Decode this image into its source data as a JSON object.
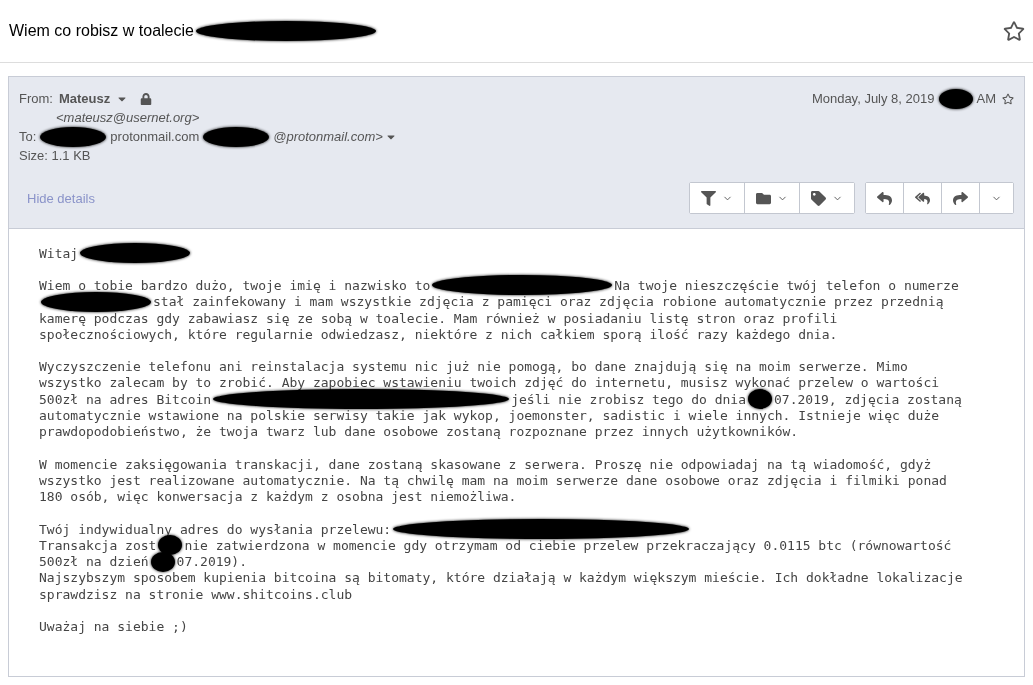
{
  "subject": {
    "segments": [
      {
        "kind": "text",
        "text": "Wiem co robisz w toalecie"
      },
      {
        "kind": "redaction_xl"
      }
    ],
    "starred": false
  },
  "header": {
    "from_label": "From:",
    "sender_name": "Mateusz",
    "sender_email": "<mateusz@usernet.org>",
    "to_label": "To:",
    "to_segments": [
      {
        "kind": "redaction_m"
      },
      {
        "kind": "text",
        "text": "protonmail.com"
      },
      {
        "kind": "redaction_m"
      },
      {
        "kind": "text",
        "text": "@protonmail.com>",
        "italic": true
      }
    ],
    "size_label": "Size: 1.1 KB",
    "date_segments": [
      {
        "kind": "text",
        "text": "Monday, July 8, 2019"
      },
      {
        "kind": "redaction_s"
      },
      {
        "kind": "text",
        "text": "AM"
      }
    ],
    "starred": false,
    "hide_details": "Hide details"
  },
  "toolbar": [
    [
      {
        "kind": "filter",
        "caret": true
      },
      {
        "kind": "folder",
        "caret": true
      },
      {
        "kind": "tag",
        "caret": true
      }
    ],
    [
      {
        "kind": "reply",
        "caret": false
      },
      {
        "kind": "reply-all",
        "caret": false
      },
      {
        "kind": "forward",
        "caret": false
      },
      {
        "kind": "more",
        "caret": true
      }
    ]
  ],
  "body": [
    [
      [
        {
          "kind": "text",
          "text": "Witaj"
        },
        {
          "kind": "redaction_l"
        }
      ]
    ],
    [
      [
        {
          "kind": "text",
          "text": "Wiem o tobie bardzo dużo, twoje imię i nazwisko to"
        },
        {
          "kind": "redaction_xl"
        },
        {
          "kind": "text",
          "text": "Na twoje nieszczęście twój telefon o numerze"
        }
      ],
      [
        {
          "kind": "redaction_l"
        },
        {
          "kind": "text",
          "text": "stał zainfekowany i mam wszystkie zdjęcia z pamięci oraz zdjęcia robione automatycznie przez przednią"
        }
      ],
      [
        {
          "kind": "text",
          "text": "kamerę podczas gdy zabawiasz się ze sobą w toalecie. Mam również w posiadaniu listę stron oraz profili"
        }
      ],
      [
        {
          "kind": "text",
          "text": "społecznościowych, które regularnie odwiedzasz, niektóre z nich całkiem sporą ilość razy każdego dnia."
        }
      ]
    ],
    [
      [
        {
          "kind": "text",
          "text": "Wyczyszczenie telefonu ani reinstalacja systemu nic już nie pomogą, bo dane znajdują się na moim serwerze. Mimo"
        }
      ],
      [
        {
          "kind": "text",
          "text": "wszystko zalecam by to zrobić. Aby zapobiec wstawieniu twoich zdjęć do internetu, musisz wykonać przelew o wartości"
        }
      ],
      [
        {
          "kind": "text",
          "text": "500zł na adres Bitcoin"
        },
        {
          "kind": "redaction_xxl"
        },
        {
          "kind": "text",
          "text": "jeśli nie zrobisz tego do dnia"
        },
        {
          "kind": "redaction_xs"
        },
        {
          "kind": "text",
          "text": "07.2019, zdjęcia zostaną"
        }
      ],
      [
        {
          "kind": "text",
          "text": "automatycznie wstawione na polskie serwisy takie jak wykop, joemonster, sadistic i wiele innych. Istnieje więc duże"
        }
      ],
      [
        {
          "kind": "text",
          "text": "prawdopodobieństwo, że twoja twarz lub dane osobowe zostaną rozpoznane przez innych użytkowników."
        }
      ]
    ],
    [
      [
        {
          "kind": "text",
          "text": "W momencie zaksięgowania transkacji, dane zostaną skasowane z serwera. Proszę nie odpowiadaj na tą wiadomość, gdyż"
        }
      ],
      [
        {
          "kind": "text",
          "text": "wszystko jest realizowane automatycznie. Na tą chwilę mam na moim serwerze dane osobowe oraz zdjęcia i filmiki ponad"
        }
      ],
      [
        {
          "kind": "text",
          "text": "180 osób, więc konwersacja z każdym z osobna jest niemożliwa."
        }
      ]
    ],
    [
      [
        {
          "kind": "text",
          "text": "Twój indywidualny adres do wysłania przelewu:"
        },
        {
          "kind": "redaction_xxl"
        }
      ],
      [
        {
          "kind": "text",
          "text": "Transakcja zost"
        },
        {
          "kind": "redaction_xs"
        },
        {
          "kind": "text",
          "text": "nie zatwierdzona w momencie gdy otrzymam od ciebie przelew przekraczający 0.0115 btc (równowartość"
        }
      ],
      [
        {
          "kind": "text",
          "text": "500zł na dzień"
        },
        {
          "kind": "redaction_xs"
        },
        {
          "kind": "text",
          "text": "07.2019)."
        }
      ],
      [
        {
          "kind": "text",
          "text": "Najszybszym sposobem kupienia bitcoina są bitomaty, które działają w każdym większym mieście. Ich dokładne lokalizacje"
        }
      ],
      [
        {
          "kind": "text",
          "text": "sprawdzisz na stronie www.shitcoins.club"
        }
      ]
    ],
    [
      [
        {
          "kind": "text",
          "text": "Uważaj na siebie ;)"
        }
      ]
    ]
  ]
}
